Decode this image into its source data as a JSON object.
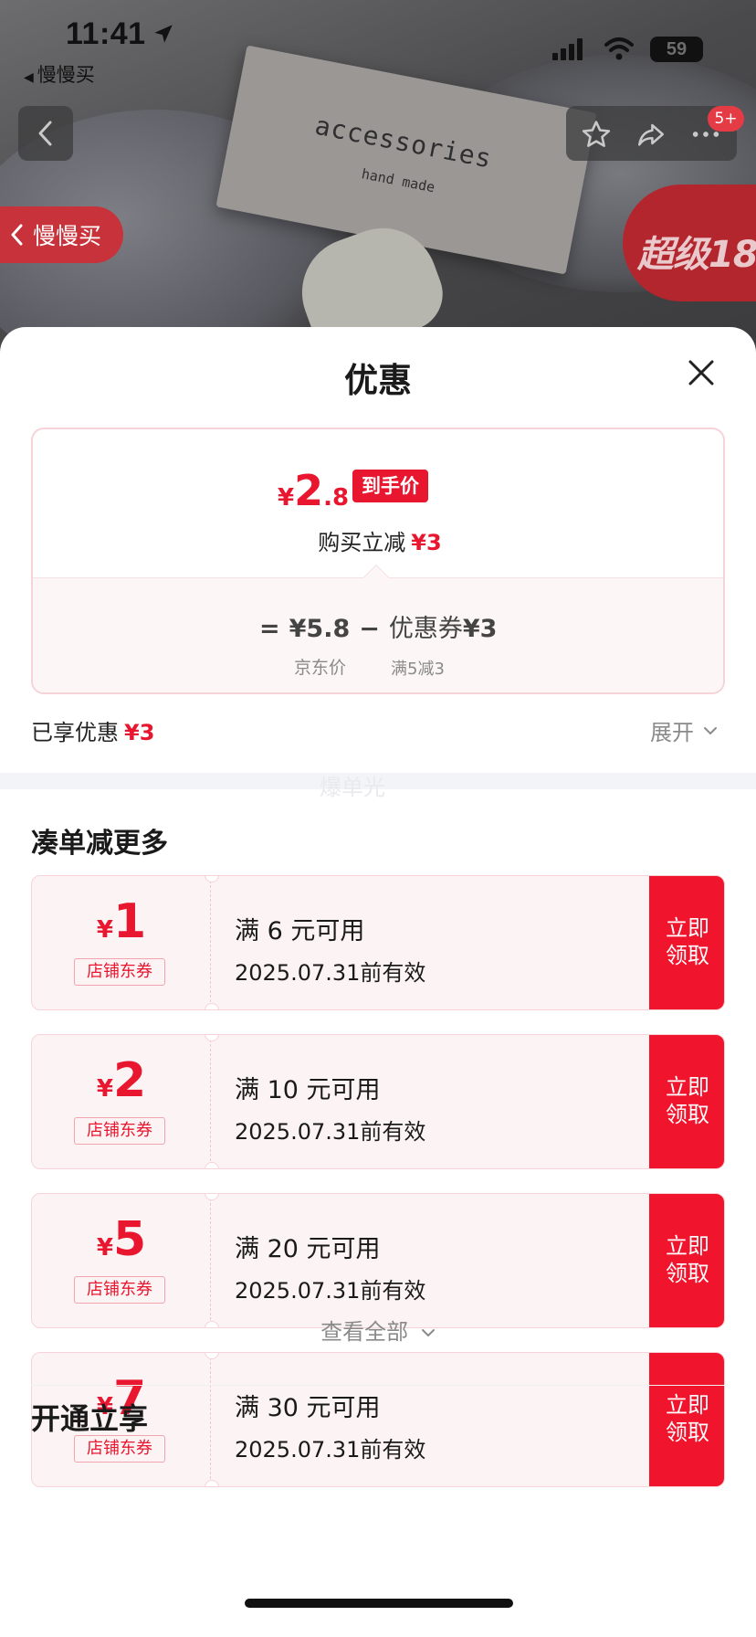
{
  "status_bar": {
    "time": "11:41",
    "back_app": "慢慢买",
    "battery": "59"
  },
  "header_badge": "5+",
  "back_pill_label": "慢慢买",
  "promo_label": "超级18",
  "product_image": {
    "box_text_1": "accessories",
    "box_text_2": "hand made"
  },
  "sheet": {
    "title": "优惠",
    "price_summary": {
      "currency": "¥",
      "final_int": "2",
      "final_dec": ".8",
      "final_tag": "到手价",
      "instant_label": "购买立减",
      "instant_value": "¥3",
      "eq": "=",
      "jd_price": "¥5.8",
      "minus": "−",
      "coupon_label": "优惠券",
      "coupon_value": "¥3",
      "jd_label": "京东价",
      "coupon_condition": "满5减3"
    },
    "enjoyed_label": "已享优惠",
    "enjoyed_value": "¥3",
    "expand_label": "展开",
    "band_text": "爆单光",
    "section_title": "凑单减更多",
    "coupons": [
      {
        "currency": "¥",
        "amount": "1",
        "type": "店铺东券",
        "condition": "满 6 元可用",
        "expiry": "2025.07.31前有效",
        "claim_line1": "立即",
        "claim_line2": "领取"
      },
      {
        "currency": "¥",
        "amount": "2",
        "type": "店铺东券",
        "condition": "满 10 元可用",
        "expiry": "2025.07.31前有效",
        "claim_line1": "立即",
        "claim_line2": "领取"
      },
      {
        "currency": "¥",
        "amount": "5",
        "type": "店铺东券",
        "condition": "满 20 元可用",
        "expiry": "2025.07.31前有效",
        "claim_line1": "立即",
        "claim_line2": "领取"
      },
      {
        "currency": "¥",
        "amount": "7",
        "type": "店铺东券",
        "condition": "满 30 元可用",
        "expiry": "2025.07.31前有效",
        "claim_line1": "立即",
        "claim_line2": "领取"
      }
    ],
    "view_all": "查看全部",
    "open_title": "开通立享"
  },
  "colors": {
    "accent_red": "#e8172f",
    "claim_red": "#f0142d",
    "coupon_bg": "#fcf3f4"
  }
}
